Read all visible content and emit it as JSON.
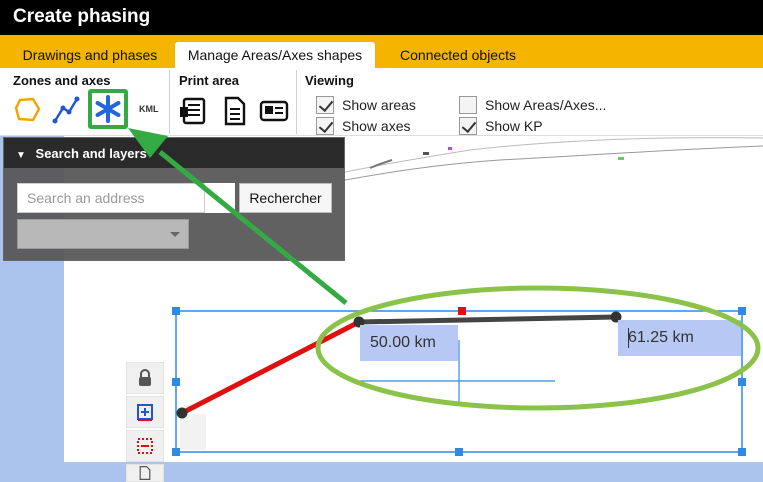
{
  "window": {
    "title": "Create phasing"
  },
  "tabs": [
    {
      "label": "Drawings and phases",
      "active": false
    },
    {
      "label": "Manage Areas/Axes shapes",
      "active": true
    },
    {
      "label": "Connected objects",
      "active": false
    }
  ],
  "ribbon": {
    "zones_group": {
      "title": "Zones and axes",
      "tools": [
        {
          "icon": "polygon-icon"
        },
        {
          "icon": "polyline-icon"
        },
        {
          "icon": "asterisk-icon",
          "highlighted": true
        },
        {
          "icon": "kml-icon",
          "label": "KML"
        }
      ]
    },
    "print_group": {
      "title": "Print area",
      "tools": [
        {
          "icon": "print-list-icon"
        },
        {
          "icon": "print-document-icon"
        },
        {
          "icon": "print-card-icon"
        }
      ]
    },
    "viewing_group": {
      "title": "Viewing",
      "options": [
        {
          "label": "Show areas",
          "checked": true
        },
        {
          "label": "Show axes",
          "checked": true
        },
        {
          "label": "Show Areas/Axes...",
          "checked": false
        },
        {
          "label": "Show KP",
          "checked": true
        }
      ]
    }
  },
  "search_panel": {
    "title": "Search and layers",
    "address_placeholder": "Search an address",
    "search_button": "Rechercher",
    "layer_select_value": ""
  },
  "map": {
    "km_labels": [
      "50.00 km",
      "61.25 km"
    ],
    "left_tools": [
      {
        "icon": "lock-icon"
      },
      {
        "icon": "add-layer-icon"
      },
      {
        "icon": "remove-layer-icon"
      },
      {
        "icon": "undo-document-icon"
      }
    ]
  },
  "colors": {
    "title_bg": "#000000",
    "tab_bar": "#f5b400",
    "highlight_green": "#33aa44",
    "annotation_green": "#8bc34a",
    "selection_blue": "#2f8ae6",
    "axis_red": "#e01010",
    "axis_dark": "#444444",
    "label_blue": "#b7c8f5"
  }
}
